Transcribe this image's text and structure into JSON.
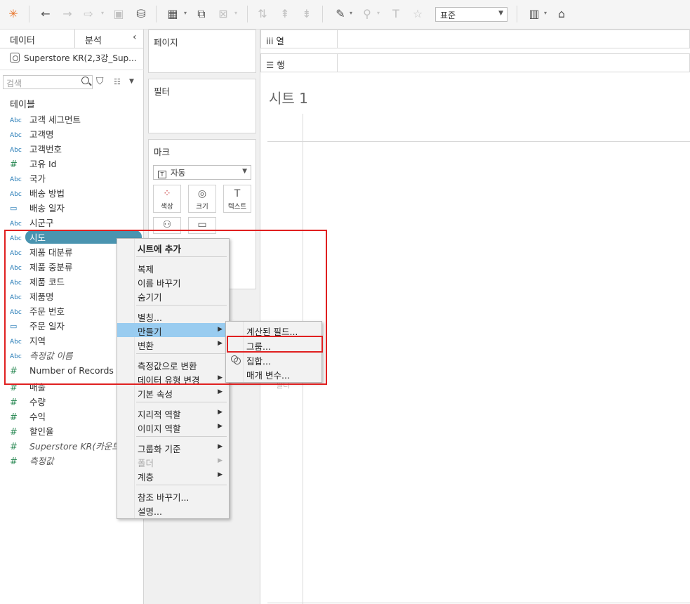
{
  "toolbar": {
    "icons": [
      "tableau-logo-icon",
      "undo-icon",
      "redo-icon",
      "swap-icon",
      "save-icon",
      "add-datasource-icon",
      "new-worksheet-icon",
      "duplicate-icon",
      "clear-icon",
      "swap-rows-cols-icon",
      "sort-asc-icon",
      "sort-desc-icon",
      "highlight-icon",
      "group-icon",
      "label-icon",
      "pin-icon",
      "show-me-icon",
      "presentation-icon"
    ],
    "fit_select": "표준"
  },
  "data_pane": {
    "tab_data": "데이터",
    "tab_analytics": "분석",
    "datasource": "Superstore KR(2,3강_Sup...",
    "search_placeholder": "검색",
    "section_title": "테이블",
    "fields": [
      {
        "type": "Abc",
        "name": "고객 세그먼트"
      },
      {
        "type": "Abc",
        "name": "고객명"
      },
      {
        "type": "Abc",
        "name": "고객번호"
      },
      {
        "type": "#",
        "name": "고유 Id"
      },
      {
        "type": "Abc",
        "name": "국가"
      },
      {
        "type": "Abc",
        "name": "배송 방법"
      },
      {
        "type": "date",
        "name": "배송 일자"
      },
      {
        "type": "Abc",
        "name": "시군구"
      },
      {
        "type": "Abc",
        "name": "시도"
      },
      {
        "type": "Abc",
        "name": "제품 대분류"
      },
      {
        "type": "Abc",
        "name": "제품 중분류"
      },
      {
        "type": "Abc",
        "name": "제품 코드"
      },
      {
        "type": "Abc",
        "name": "제품명"
      },
      {
        "type": "Abc",
        "name": "주문 번호"
      },
      {
        "type": "date",
        "name": "주문 일자"
      },
      {
        "type": "Abc",
        "name": "지역"
      },
      {
        "type": "Abc",
        "name": "측정값 이름"
      },
      {
        "type": "#",
        "name": "Number of Records"
      },
      {
        "type": "#",
        "name": "매출"
      },
      {
        "type": "#",
        "name": "수량"
      },
      {
        "type": "#",
        "name": "수익"
      },
      {
        "type": "#",
        "name": "할인율"
      },
      {
        "type": "#",
        "name": "Superstore KR(카운트)"
      },
      {
        "type": "#",
        "name": "측정값"
      }
    ]
  },
  "shelves": {
    "pages": "페이지",
    "filters": "필터",
    "marks": "마크",
    "mark_type": "자동",
    "mark_type_icon": "T",
    "mark_color": "색상",
    "mark_size": "크기",
    "mark_text": "텍스트",
    "columns_icon": "iii",
    "columns": "열",
    "rows_icon": "☰",
    "rows": "행"
  },
  "sheet": {
    "title": "시트 1"
  },
  "context_menu": {
    "add_to_sheet": "시트에 추가",
    "duplicate": "복제",
    "rename": "이름 바꾸기",
    "hide": "숨기기",
    "alias": "별칭...",
    "create": "만들기",
    "transform": "변환",
    "convert_to_measure": "측정값으로 변환",
    "change_data_type": "데이터 유형 변경",
    "default_properties": "기본 속성",
    "geographic_role": "지리적 역할",
    "image_role": "이미지 역할",
    "group_by": "그룹화 기준",
    "folder": "폴더",
    "hierarchy": "계층",
    "replace_references": "참조 바꾸기...",
    "describe": "설명..."
  },
  "submenu": {
    "calculated_field": "계산된 필드...",
    "group": "그룹...",
    "set": "집합...",
    "parameter": "매개 변수..."
  },
  "ghost_text": "필터"
}
